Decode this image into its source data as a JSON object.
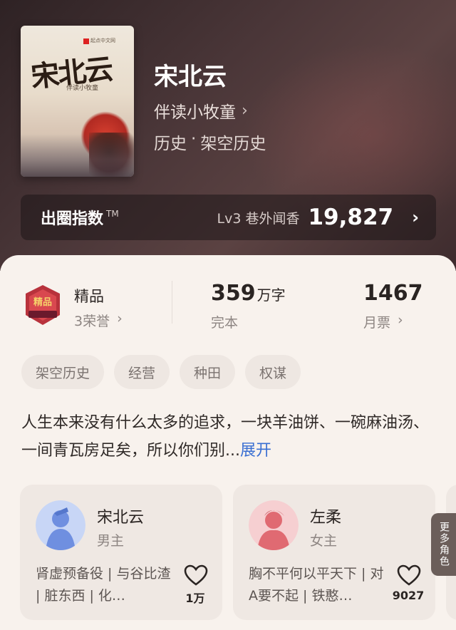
{
  "book": {
    "title": "宋北云",
    "author": "伴读小牧童",
    "category": "历史",
    "separator": "·",
    "subcategory": "架空历史",
    "cover": {
      "title": "宋北云",
      "author": "伴读小牧童",
      "badge": "起点中文网"
    }
  },
  "index_bar": {
    "label": "出圈指数",
    "trademark": "TM",
    "level": "Lv3 巷外闻香",
    "value": "19,827"
  },
  "stats": {
    "quality_title": "精品",
    "honors": "3荣誉",
    "word_count": "359",
    "word_unit": "万字",
    "status": "完本",
    "monthly_votes": "1467",
    "votes_label": "月票"
  },
  "medal_text": "精品 驿站",
  "tags": [
    "架空历史",
    "经营",
    "种田",
    "权谋"
  ],
  "synopsis": {
    "text": "人生本来没有什么太多的追求，一块羊油饼、一碗麻油汤、一间青瓦房足矣，所以你们别...",
    "more": "展开"
  },
  "characters": [
    {
      "name": "宋北云",
      "role": "男主",
      "description": "肾虚预备役 | 与谷比渣 | 脏东西 | 化…",
      "likes": "1万",
      "avatar_color": "#6f8fe0"
    },
    {
      "name": "左柔",
      "role": "女主",
      "description": "胸不平何以平天下 | 对A要不起 | 铁憨…",
      "likes": "9027",
      "avatar_color": "#e06a72"
    }
  ],
  "more_characters": "更多角色",
  "icons": {
    "chevron": "chevron-right-icon",
    "heart": "heart-icon"
  },
  "colors": {
    "accent_link": "#3a6fd2",
    "hero_bg": "#4a3638"
  }
}
